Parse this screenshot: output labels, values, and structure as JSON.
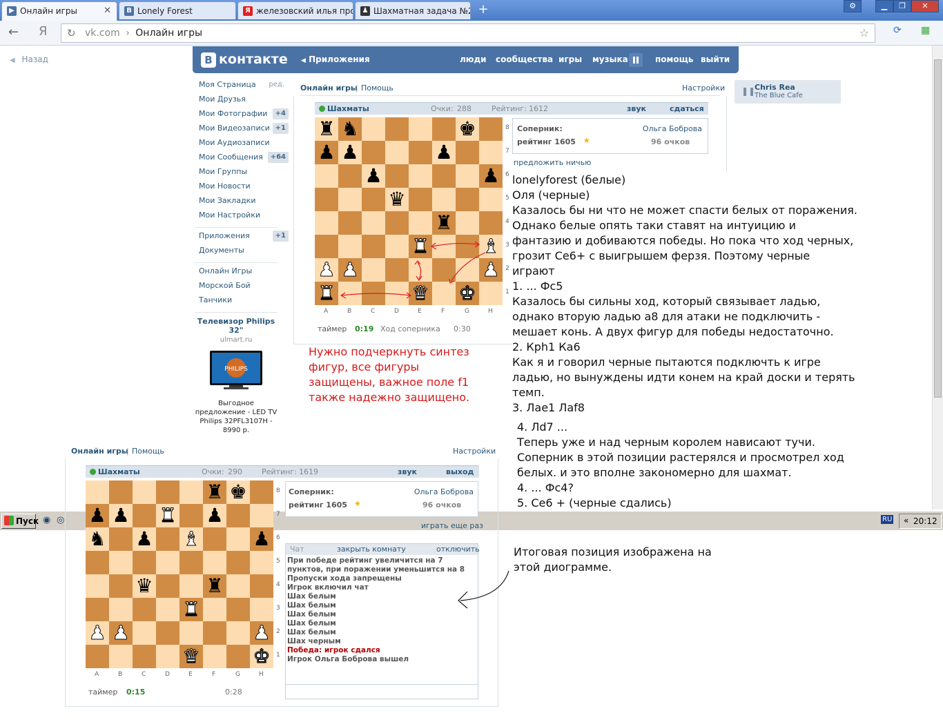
{
  "browser": {
    "tabs": [
      {
        "title": "Онлайн игры",
        "fav": "▶",
        "favcolor": "#4b72a4",
        "active": true
      },
      {
        "title": "Lonely Forest",
        "fav": "B",
        "favcolor": "#4b72a4",
        "active": false
      },
      {
        "title": "железовский илья проз",
        "fav": "Я",
        "favcolor": "#e02020",
        "active": false
      },
      {
        "title": "Шахматная задача №2",
        "fav": "♟",
        "favcolor": "#333",
        "active": false
      }
    ],
    "new_tab": "+",
    "url_domain": "vk.com",
    "url_sep": "›",
    "url_title": "Онлайн игры",
    "yandex": "Я"
  },
  "vk": {
    "back": "Назад",
    "logo_b": "B",
    "logo_text": "контакте",
    "apps_link": "Приложения",
    "nav": [
      "люди",
      "сообщества",
      "игры",
      "музыка",
      "помощь",
      "выйти"
    ],
    "menu": [
      {
        "label": "Моя Страница",
        "extra": "ред."
      },
      {
        "label": "Мои Друзья"
      },
      {
        "label": "Мои Фотографии",
        "count": "+4"
      },
      {
        "label": "Мои Видеозаписи",
        "count": "+1"
      },
      {
        "label": "Мои Аудиозаписи"
      },
      {
        "label": "Мои Сообщения",
        "count": "+64"
      },
      {
        "label": "Мои Группы"
      },
      {
        "label": "Мои Новости"
      },
      {
        "label": "Мои Закладки"
      },
      {
        "label": "Мои Настройки"
      }
    ],
    "menu2": [
      {
        "label": "Приложения",
        "count": "+1"
      },
      {
        "label": "Документы"
      }
    ],
    "menu3": [
      {
        "label": "Онлайн Игры"
      },
      {
        "label": "Морской Бой"
      },
      {
        "label": "Танчики"
      }
    ],
    "ad": {
      "title": "Телевизор Philips 32\"",
      "domain": "ulmart.ru",
      "brand": "PHILIPS",
      "desc": "Выгодное предложение - LED TV Philips 32PFL3107H - 8990 р."
    },
    "player": {
      "artist": "Chris Rea",
      "track": "The Blue Cafe"
    }
  },
  "game1": {
    "tab_online": "Онлайн игры",
    "tab_sep": "|",
    "tab_help": "Помощь",
    "tab_settings": "Настройки",
    "title": "Шахматы",
    "points_label": "Очки:",
    "points": "288",
    "rating_label": "Рейтинг:",
    "rating": "1612",
    "sound": "звук",
    "resign": "сдаться",
    "opp_label": "Соперник:",
    "opp_name": "Ольга Боброва",
    "opp_rating": "рейтинг 1605",
    "opp_points": "96 очков",
    "draw": "предложить ничью",
    "timer_label": "таймер",
    "timer": "0:19",
    "turn": "Ход соперника",
    "timer2": "0:30",
    "board": [
      "r.....k.",
      "pp...p..",
      "..p....p",
      "...q....",
      ".....r..",
      "....R..B",
      "PP.....P",
      "R...Q.K."
    ],
    "board_knight_b8": "n"
  },
  "game2": {
    "tab_online": "Онлайн игры",
    "tab_sep": "|",
    "tab_help": "Помощь",
    "tab_settings": "Настройки",
    "title": "Шахматы",
    "points_label": "Очки:",
    "points": "290",
    "rating_label": "Рейтинг:",
    "rating": "1619",
    "sound": "звук",
    "exit": "выход",
    "opp_label": "Соперник:",
    "opp_name": "Ольга Боброва",
    "opp_rating": "рейтинг 1605",
    "opp_points": "96 очков",
    "play_again": "играть еще раз",
    "chat_label": "Чат",
    "chat_close": "закрыть комнату",
    "chat_off": "отключить",
    "chat": [
      {
        "text": "При победе рейтинг увеличится на 7",
        "red": false
      },
      {
        "text": "пунктов, при поражении уменьшится на 8",
        "red": false
      },
      {
        "text": "Пропуски хода запрещены",
        "red": false
      },
      {
        "text": "Игрок включил чат",
        "red": false
      },
      {
        "text": "Шах белым",
        "red": false
      },
      {
        "text": "Шах белым",
        "red": false
      },
      {
        "text": "Шах белым",
        "red": false
      },
      {
        "text": "Шах белым",
        "red": false
      },
      {
        "text": "Шах белым",
        "red": false
      },
      {
        "text": "Шах черным",
        "red": false
      },
      {
        "text": "Победа: игрок сдался",
        "red": true
      },
      {
        "text": "Игрок Ольга Боброва вышел",
        "red": false
      }
    ],
    "timer_label": "таймер",
    "timer": "0:15",
    "timer2": "0:28",
    "board": [
      ".....rk.",
      "pp.R.p..",
      "n.p.B..p",
      "........",
      "..q..r..",
      "....R...",
      "PP.....P",
      "....Q..K"
    ]
  },
  "files": [
    "A",
    "B",
    "C",
    "D",
    "E",
    "F",
    "G",
    "H"
  ],
  "ranks": [
    "8",
    "7",
    "6",
    "5",
    "4",
    "3",
    "2",
    "1"
  ],
  "annotation_red": [
    "Нужно подчеркнуть синтез",
    "фигур, все фигуры",
    "защищены, важное поле f1",
    "также надежно защищено."
  ],
  "annotation_main": [
    "lonelyforest (белые)",
    "Оля (черные)",
    "Казалось бы ни что не может спасти белых от поражения.",
    "Однако белые опять таки ставят на интуицию и",
    "фантазию и добиваются победы. Но пока что ход черных,",
    "грозит Се6+ с выигрышем ферзя. Поэтому черные",
    "играют",
    "1. ... Фс5",
    "Казалось бы сильны ход, который связывает ладью,",
    "однако вторую ладью а8 для атаки не подключить -",
    "мешает конь. А двух фигур для победы недостаточно.",
    "2. Крh1 Ка6",
    "Как я и говорил черные пытаются подключть к игре",
    "ладью, но вынуждены идти конем на край доски и терять",
    "темп.",
    "3. Лае1 Лаf8"
  ],
  "annotation_main2": [
    "4. Лd7 ...",
    "Теперь уже и над черным королем нависают тучи.",
    "Соперник в этой позиции растерялся и просмотрел ход",
    "белых. и это вполне закономерно для шахмат.",
    "4. ... Фс4?",
    "5. Се6 +         (черные сдались)"
  ],
  "annotation_final": [
    "Итоговая позиция изображена на",
    "этой диограмме."
  ],
  "taskbar": {
    "start": "Пуск",
    "lang": "RU",
    "chev": "«",
    "clock": "20:12"
  }
}
